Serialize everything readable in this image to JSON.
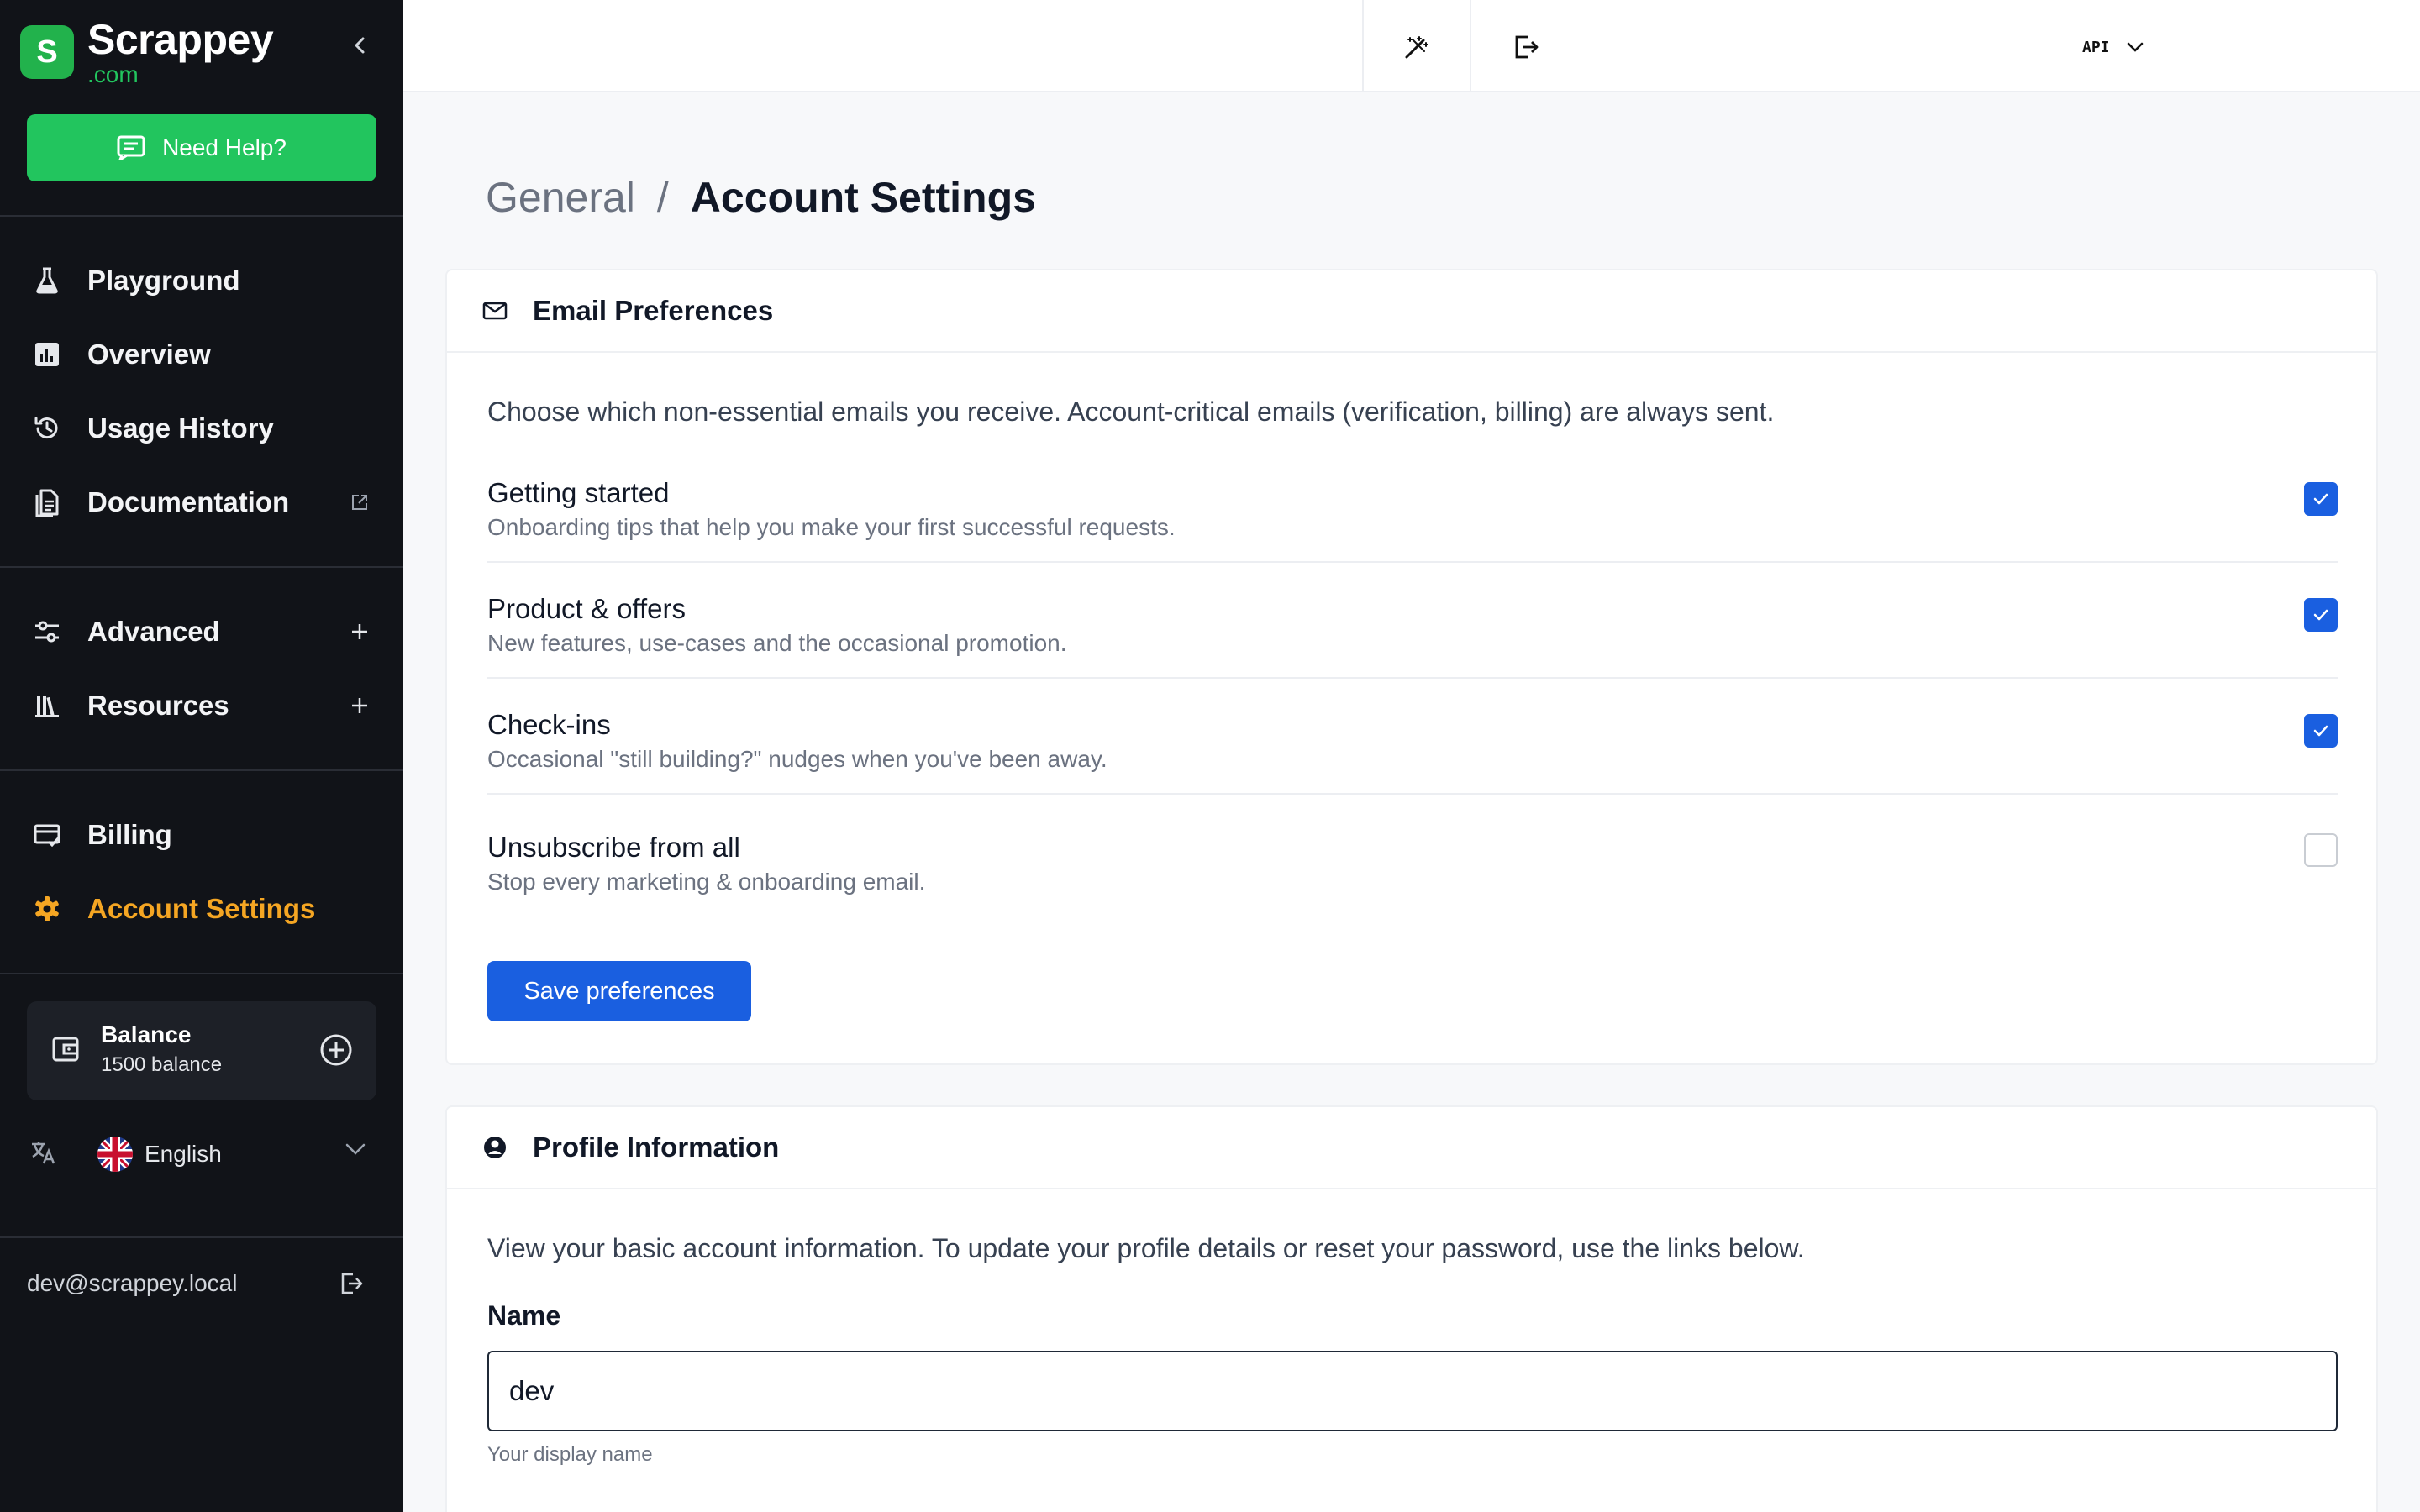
{
  "brand": {
    "logo_letter": "S",
    "name": "Scrappey",
    "domain": ".com"
  },
  "help_button": {
    "label": "Need Help?"
  },
  "nav": {
    "main": [
      {
        "label": "Playground",
        "icon": "flask-icon"
      },
      {
        "label": "Overview",
        "icon": "chart-icon"
      },
      {
        "label": "Usage History",
        "icon": "history-icon"
      },
      {
        "label": "Documentation",
        "icon": "document-icon",
        "trailing_icon": "external-link-icon"
      }
    ],
    "sections": [
      {
        "label": "Advanced",
        "icon": "sliders-icon",
        "trailing_icon": "plus-icon"
      },
      {
        "label": "Resources",
        "icon": "library-icon",
        "trailing_icon": "plus-icon"
      }
    ],
    "account": [
      {
        "label": "Billing",
        "icon": "credit-card-icon"
      },
      {
        "label": "Account Settings",
        "icon": "gear-icon",
        "active": true
      }
    ]
  },
  "balance": {
    "title": "Balance",
    "subtitle": "1500 balance"
  },
  "language": {
    "selected": "English"
  },
  "user": {
    "email": "dev@scrappey.local"
  },
  "topbar": {
    "api_label": "API"
  },
  "breadcrumb": {
    "parent": "General",
    "separator": "/",
    "current": "Account Settings"
  },
  "email_prefs": {
    "title": "Email Preferences",
    "description": "Choose which non-essential emails you receive. Account-critical emails (verification, billing) are always sent.",
    "items": [
      {
        "title": "Getting started",
        "subtitle": "Onboarding tips that help you make your first successful requests.",
        "checked": true
      },
      {
        "title": "Product & offers",
        "subtitle": "New features, use-cases and the occasional promotion.",
        "checked": true
      },
      {
        "title": "Check-ins",
        "subtitle": "Occasional \"still building?\" nudges when you've been away.",
        "checked": true
      },
      {
        "title": "Unsubscribe from all",
        "subtitle": "Stop every marketing & onboarding email.",
        "checked": false
      }
    ],
    "save_label": "Save preferences"
  },
  "profile": {
    "title": "Profile Information",
    "description": "View your basic account information. To update your profile details or reset your password, use the links below.",
    "name_label": "Name",
    "name_value": "dev",
    "name_hint": "Your display name"
  },
  "colors": {
    "sidebar_bg": "#111318",
    "brand_green": "#22c55e",
    "active_nav": "#f5a623",
    "primary_blue": "#1a5fe0"
  }
}
